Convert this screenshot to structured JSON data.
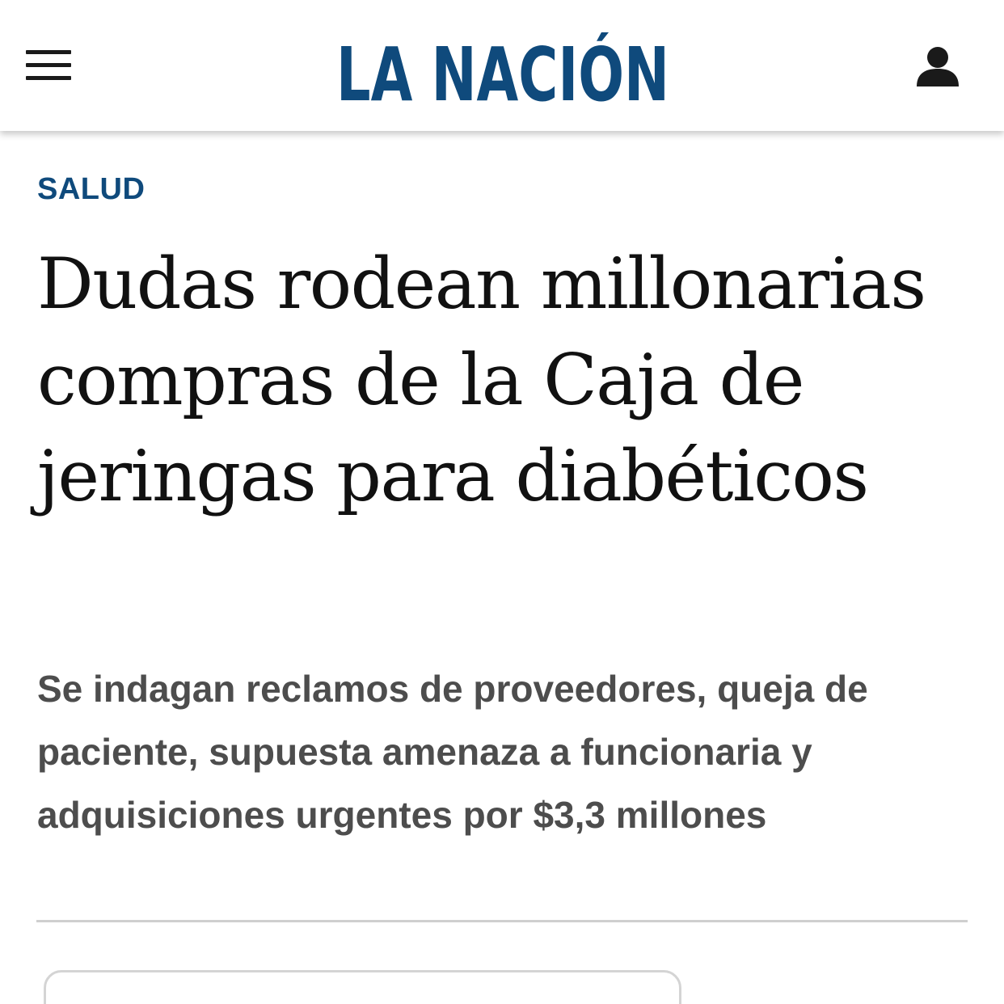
{
  "header": {
    "logo_text": "LA NACIÓN",
    "menu_icon": "hamburger-menu-icon",
    "user_icon": "user-account-icon"
  },
  "article": {
    "section": "SALUD",
    "headline": "Dudas rodean millonarias compras de la Caja de jeringas para diabéticos",
    "subheadline": "Se indagan reclamos de proveedores, queja de paciente, supuesta amenaza a funcionaria y adquisiciones urgentes por $3,3 millones"
  },
  "colors": {
    "brand_blue": "#0f4a7c",
    "headline": "#111111",
    "subheadline": "#4d4d4d",
    "divider": "#cfcfcf"
  }
}
